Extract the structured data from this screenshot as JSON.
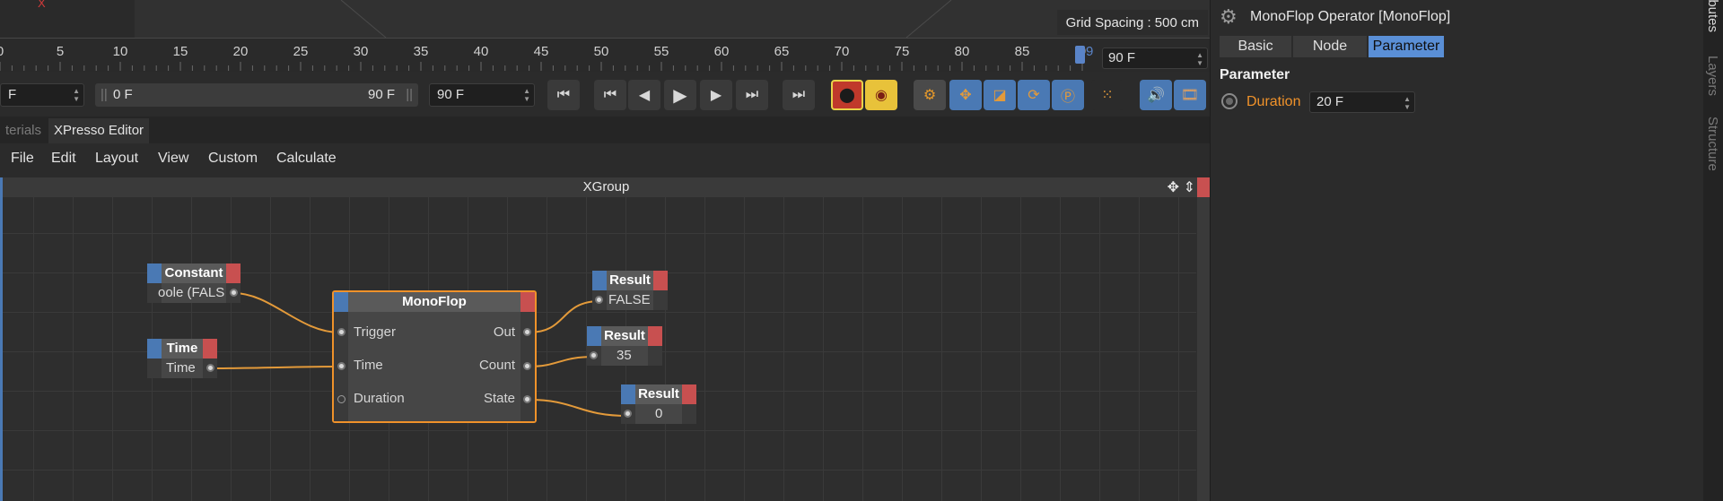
{
  "viewport": {
    "grid_spacing": "Grid Spacing : 500 cm",
    "axis_mark": "X"
  },
  "timeline": {
    "ticks": [
      "0",
      "5",
      "10",
      "15",
      "20",
      "25",
      "30",
      "35",
      "40",
      "45",
      "50",
      "55",
      "60",
      "65",
      "70",
      "75",
      "80",
      "85",
      "9"
    ],
    "playhead_label": "9",
    "end_frame": "90 F",
    "start_field": "F",
    "range_start": "0 F",
    "range_end": "90 F",
    "max_field": "90 F"
  },
  "transport": {
    "icons": [
      "go-to-start-icon",
      "prev-key-icon",
      "prev-frame-icon",
      "play-icon",
      "next-frame-icon",
      "next-key-icon",
      "go-to-end-icon",
      "record-icon",
      "autokey-icon",
      "keyframe-selection-icon",
      "move-key-icon",
      "scale-key-icon",
      "rotate-key-icon",
      "param-key-icon",
      "point-level-icon",
      "sound-icon",
      "film-icon"
    ]
  },
  "tabs": [
    {
      "label": "terials",
      "active": false
    },
    {
      "label": "XPresso Editor",
      "active": true
    }
  ],
  "menu": [
    "File",
    "Edit",
    "Layout",
    "View",
    "Custom",
    "Calculate"
  ],
  "xgroup": {
    "title": "XGroup",
    "nodes": {
      "constant": {
        "title": "Constant",
        "value": "oole (FALS"
      },
      "time": {
        "title": "Time",
        "port": "Time"
      },
      "monoflop": {
        "title": "MonoFlop",
        "inputs": [
          "Trigger",
          "Time",
          "Duration"
        ],
        "outputs": [
          "Out",
          "Count",
          "State"
        ]
      },
      "result1": {
        "title": "Result",
        "value": "FALSE"
      },
      "result2": {
        "title": "Result",
        "value": "35"
      },
      "result3": {
        "title": "Result",
        "value": "0"
      }
    }
  },
  "attributes": {
    "title": "MonoFlop Operator [MonoFlop]",
    "tabs": [
      "Basic",
      "Node",
      "Parameter"
    ],
    "active_tab": "Parameter",
    "section": "Parameter",
    "param_label": "Duration",
    "param_value": "20 F"
  },
  "side_tabs": [
    "ibutes",
    "Layers",
    "Structure"
  ],
  "colors": {
    "accent_blue": "#5a8fd6",
    "node_border": "#f0922a",
    "wire": "#e39a3a",
    "port_in": "#4a79b4",
    "port_out": "#c85050"
  }
}
